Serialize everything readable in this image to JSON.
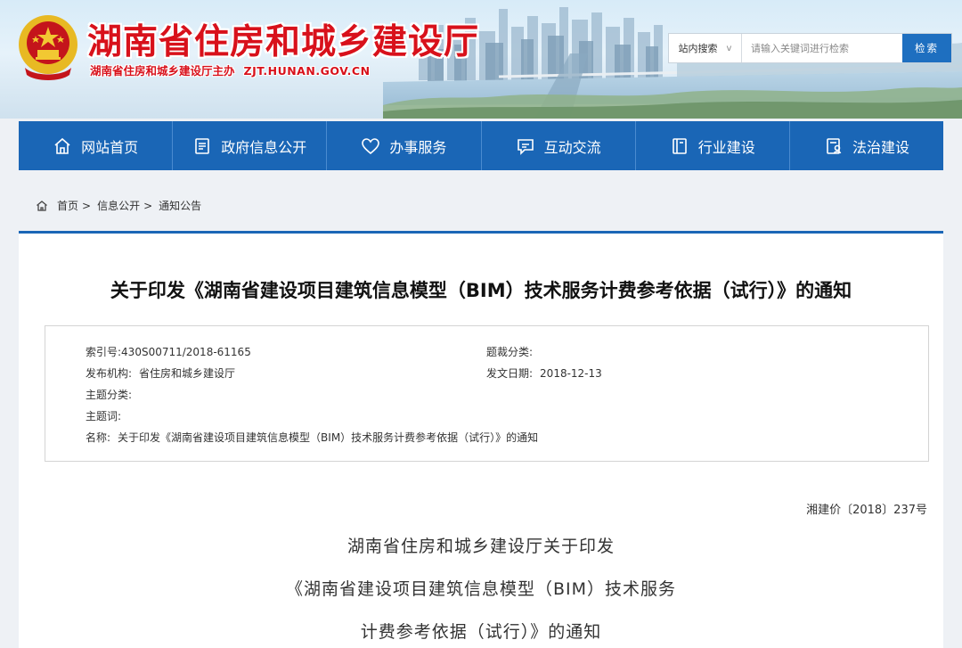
{
  "header": {
    "site_title": "湖南省住房和城乡建设厅",
    "subtitle": "湖南省住房和城乡建设厅主办",
    "url": "ZJT.HUNAN.GOV.CN",
    "title_color": "#d8111b"
  },
  "search": {
    "scope": "站内搜索",
    "placeholder": "请输入关键词进行检索",
    "button": "检索"
  },
  "nav": {
    "color": "#1a66b6",
    "items": [
      {
        "label": "网站首页",
        "icon": "home-icon"
      },
      {
        "label": "政府信息公开",
        "icon": "document-list-icon"
      },
      {
        "label": "办事服务",
        "icon": "heart-icon"
      },
      {
        "label": "互动交流",
        "icon": "chat-icon"
      },
      {
        "label": "行业建设",
        "icon": "book-icon"
      },
      {
        "label": "法治建设",
        "icon": "clipboard-person-icon"
      }
    ]
  },
  "breadcrumb": {
    "icon": "home-icon",
    "items": [
      "首页",
      "信息公开",
      "通知公告"
    ],
    "separator": ">"
  },
  "article": {
    "title": "关于印发《湖南省建设项目建筑信息模型（BIM）技术服务计费参考依据（试行）》的通知",
    "meta": {
      "index_label": "索引号:",
      "index_value": "430S00711/2018-61165",
      "genre_label": "题裁分类:",
      "genre_value": "",
      "publisher_label": "发布机构:",
      "publisher_value": "省住房和城乡建设厅",
      "date_label": "发文日期:",
      "date_value": "2018-12-13",
      "topic_label": "主题分类:",
      "topic_value": "",
      "keyword_label": "主题词:",
      "keyword_value": "",
      "name_label": "名称:",
      "name_value": "关于印发《湖南省建设项目建筑信息模型（BIM）技术服务计费参考依据（试行）》的通知"
    },
    "doc_number": "湘建价〔2018〕237号",
    "heading_lines": [
      "湖南省住房和城乡建设厅关于印发",
      "《湖南省建设项目建筑信息模型（BIM）技术服务",
      "计费参考依据（试行）》的通知"
    ]
  }
}
